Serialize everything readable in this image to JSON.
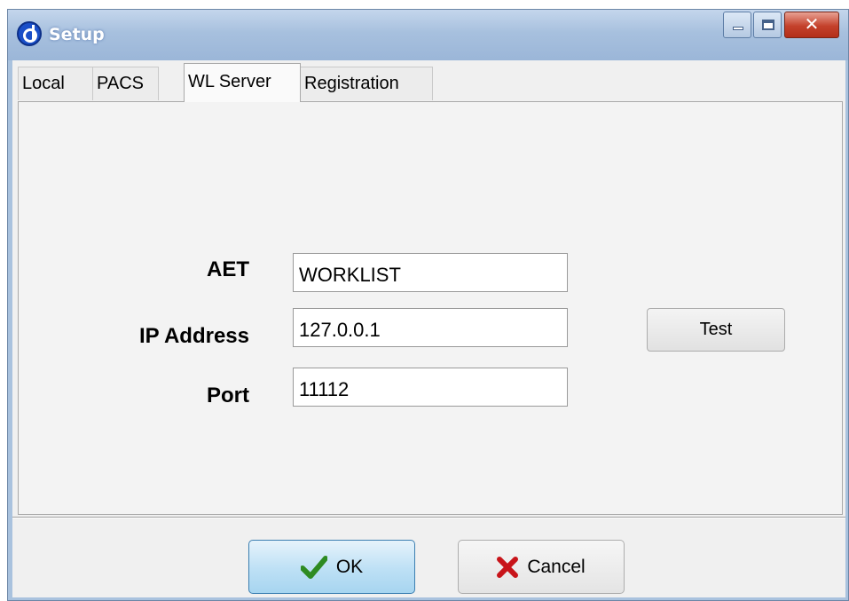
{
  "window": {
    "title": "Setup",
    "icon": "app-logo-icon",
    "controls": {
      "minimize": "minimize-icon",
      "maximize": "maximize-icon",
      "close": "✕"
    }
  },
  "tabs": [
    {
      "label": "Local"
    },
    {
      "label": "PACS"
    },
    {
      "label": "WL Server",
      "selected": true
    },
    {
      "label": "Registration"
    }
  ],
  "form": {
    "aet": {
      "label": "AET",
      "value": "WORKLIST"
    },
    "ip": {
      "label": "IP Address",
      "value": "127.0.0.1"
    },
    "port": {
      "label": "Port",
      "value": "11112"
    },
    "test_label": "Test"
  },
  "footer": {
    "ok_label": "OK",
    "ok_icon": "checkmark-icon",
    "cancel_label": "Cancel",
    "cancel_icon": "red-x-icon"
  },
  "colors": {
    "titlebar": "#a7c0de",
    "close_button": "#c4412b",
    "ok_button": "#bde0f5",
    "check_green": "#2e8b22",
    "cancel_red": "#c8141a"
  }
}
